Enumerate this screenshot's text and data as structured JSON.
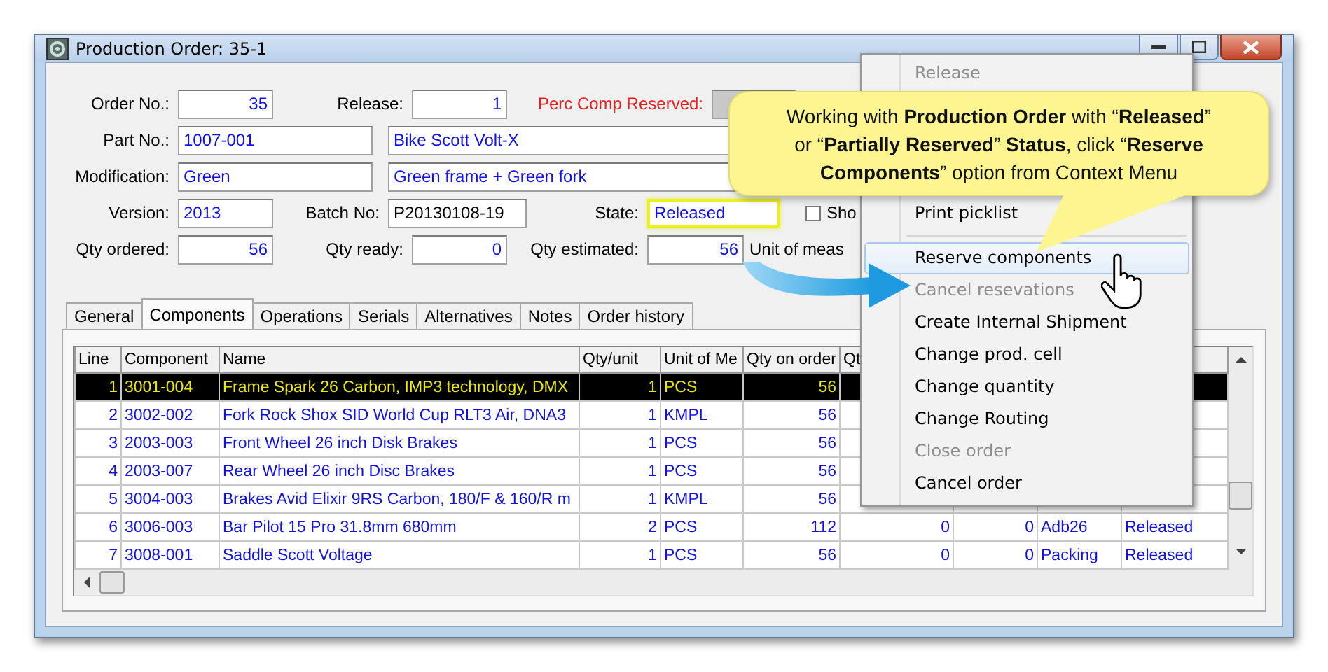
{
  "window": {
    "title": "Production Order: 35-1"
  },
  "form": {
    "order_no": {
      "label": "Order No.:",
      "value": "35"
    },
    "release": {
      "label": "Release:",
      "value": "1"
    },
    "perc_comp_reserved": {
      "label": "Perc Comp Reserved:"
    },
    "part_no": {
      "label": "Part No.:",
      "value": "1007-001",
      "description": "Bike Scott Volt-X"
    },
    "modification": {
      "label": "Modification:",
      "value": "Green",
      "description": "Green frame + Green fork"
    },
    "version": {
      "label": "Version:",
      "value": "2013"
    },
    "batch_no": {
      "label": "Batch No:",
      "value": "P20130108-19"
    },
    "state": {
      "label": "State:",
      "value": "Released",
      "highlighted": true
    },
    "show_option": {
      "label": "Sho",
      "checked": false
    },
    "qty_ordered": {
      "label": "Qty ordered:",
      "value": "56"
    },
    "qty_ready": {
      "label": "Qty ready:",
      "value": "0"
    },
    "qty_estimated": {
      "label": "Qty estimated:",
      "value": "56"
    },
    "unit_of_measure": {
      "label": "Unit of meas"
    }
  },
  "tabs": [
    {
      "label": "General",
      "selected": false
    },
    {
      "label": "Components",
      "selected": true
    },
    {
      "label": "Operations",
      "selected": false
    },
    {
      "label": "Serials",
      "selected": false
    },
    {
      "label": "Alternatives",
      "selected": false
    },
    {
      "label": "Notes",
      "selected": false
    },
    {
      "label": "Order history",
      "selected": false
    }
  ],
  "table": {
    "columns": [
      "Line",
      "Component",
      "Name",
      "Qty/unit",
      "Unit of Me",
      "Qty on order",
      "Qt"
    ],
    "rows": [
      {
        "selected": true,
        "cells": [
          "1",
          "3001-004",
          "Frame Spark 26 Carbon, IMP3 technology, DMX",
          "1",
          "PCS",
          "56"
        ]
      },
      {
        "selected": false,
        "cells": [
          "2",
          "3002-002",
          "Fork Rock Shox SID World Cup RLT3 Air, DNA3",
          "1",
          "KMPL",
          "56"
        ]
      },
      {
        "selected": false,
        "cells": [
          "3",
          "2003-003",
          "Front Wheel 26 inch Disk Brakes",
          "1",
          "PCS",
          "56"
        ]
      },
      {
        "selected": false,
        "cells": [
          "4",
          "2003-007",
          "Rear Wheel 26 inch Disc Brakes",
          "1",
          "PCS",
          "56"
        ]
      },
      {
        "selected": false,
        "cells": [
          "5",
          "3004-003",
          "Brakes Avid Elixir 9RS Carbon, 180/F & 160/R m",
          "1",
          "KMPL",
          "56"
        ]
      },
      {
        "selected": false,
        "cells": [
          "6",
          "3006-003",
          "Bar Pilot 15 Pro 31.8mm 680mm",
          "2",
          "PCS",
          "112",
          "0",
          "0",
          "Adb26",
          "Released"
        ]
      },
      {
        "selected": false,
        "cells": [
          "7",
          "3008-001",
          "Saddle Scott Voltage",
          "1",
          "PCS",
          "56",
          "0",
          "0",
          "Packing",
          "Released"
        ]
      }
    ]
  },
  "context_menu": {
    "items": [
      {
        "kind": "item",
        "label": "Release",
        "disabled": true,
        "selected": false
      },
      {
        "kind": "item",
        "label": "Print picklist",
        "disabled": false,
        "selected": false
      },
      {
        "kind": "separator"
      },
      {
        "kind": "item",
        "label": "Reserve components",
        "disabled": false,
        "selected": true
      },
      {
        "kind": "item",
        "label": "Cancel resevations",
        "disabled": true,
        "selected": false
      },
      {
        "kind": "item",
        "label": "Create Internal Shipment",
        "disabled": false,
        "selected": false
      },
      {
        "kind": "item",
        "label": "Change prod. cell",
        "disabled": false,
        "selected": false
      },
      {
        "kind": "item",
        "label": "Change quantity",
        "disabled": false,
        "selected": false
      },
      {
        "kind": "item",
        "label": "Change Routing",
        "disabled": false,
        "selected": false
      },
      {
        "kind": "item",
        "label": "Close order",
        "disabled": true,
        "selected": false
      },
      {
        "kind": "item",
        "label": "Cancel order",
        "disabled": false,
        "selected": false
      }
    ]
  },
  "callout": {
    "text": "Working with **Production  Order** with “**Released**” or “**Partially Reserved**” **Status**, click “**Reserve Components**” option from Context Menu"
  }
}
